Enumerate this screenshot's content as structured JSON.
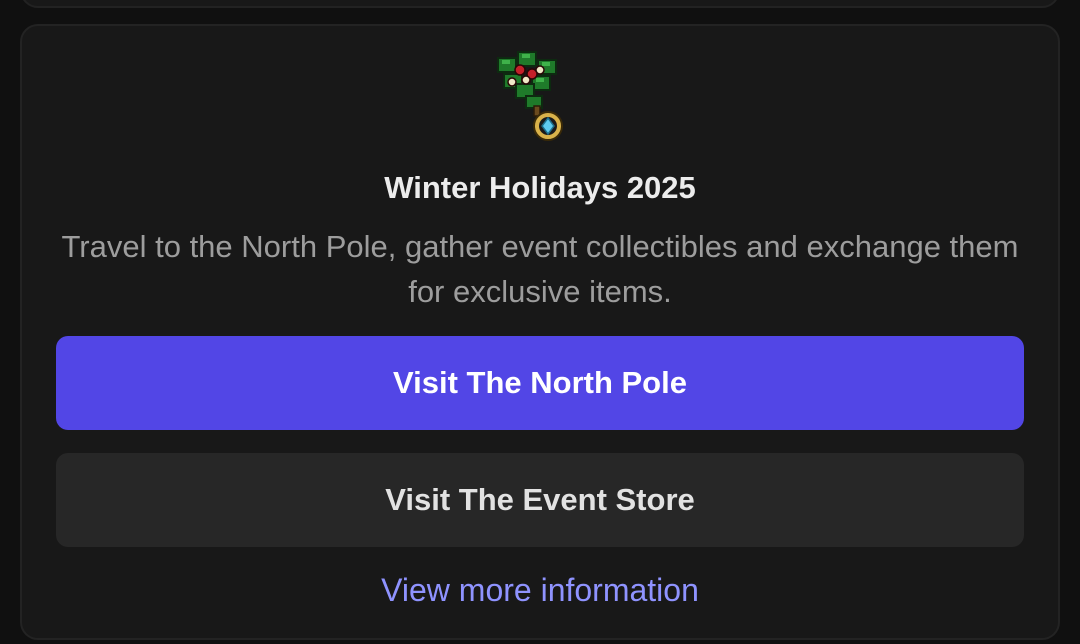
{
  "event": {
    "icon": "holly-mistletoe-icon",
    "title": "Winter Holidays 2025",
    "description": "Travel to the North Pole, gather event collectibles and exchange them for exclusive items."
  },
  "actions": {
    "primary_label": "Visit The North Pole",
    "secondary_label": "Visit The Event Store",
    "link_label": "View more information"
  },
  "colors": {
    "background": "#101010",
    "card": "#181818",
    "primary_button": "#5246e6",
    "secondary_button": "#272727",
    "link": "#8f93ff",
    "title_text": "#ececec",
    "body_text": "#9d9d9d"
  }
}
